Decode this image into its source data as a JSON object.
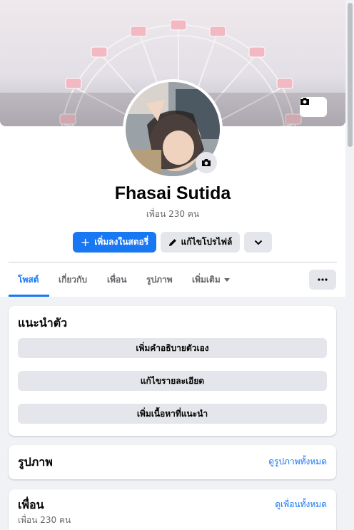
{
  "profile": {
    "name": "Fhasai Sutida",
    "friends_count_text": "เพื่อน 230 คน"
  },
  "actions": {
    "add_story_label": "เพิ่มลงในสตอรี่",
    "edit_profile_label": "แก้ไขโปรไฟล์"
  },
  "tabs": [
    {
      "label": "โพสต์",
      "active": true
    },
    {
      "label": "เกี่ยวกับ",
      "active": false
    },
    {
      "label": "เพื่อน",
      "active": false
    },
    {
      "label": "รูปภาพ",
      "active": false
    },
    {
      "label": "เพิ่มเติม",
      "active": false
    }
  ],
  "intro": {
    "title": "แนะนำตัว",
    "buttons": [
      "เพิ่มคำอธิบายตัวเอง",
      "แก้ไขรายละเอียด",
      "เพิ่มเนื้อหาที่แนะนำ"
    ]
  },
  "photos": {
    "title": "รูปภาพ",
    "link": "ดูรูปภาพทั้งหมด"
  },
  "friends": {
    "title": "เพื่อน",
    "link": "ดูเพื่อนทั้งหมด",
    "count_text": "เพื่อน 230 คน"
  },
  "colors": {
    "accent": "#1877f2",
    "secondary_button": "#e4e6eb",
    "background": "#f0f2f5"
  },
  "icons": [
    "camera-icon",
    "plus-icon",
    "pencil-icon",
    "chevron-down-icon",
    "more-icon",
    "caret-down-icon"
  ]
}
